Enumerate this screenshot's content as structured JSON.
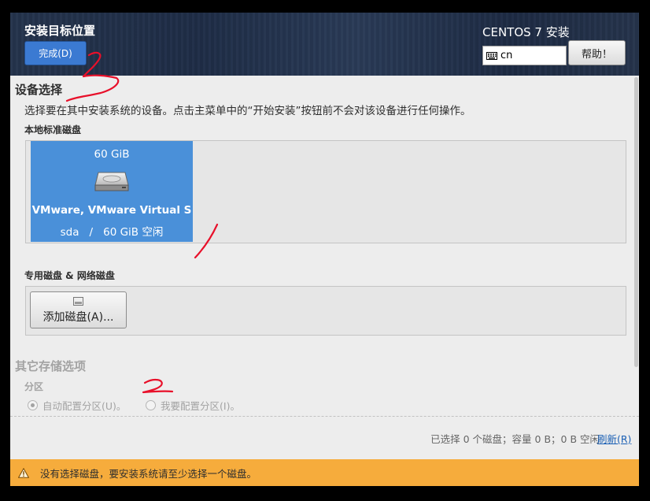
{
  "header": {
    "title": "安装目标位置",
    "done_label": "完成(D)",
    "product": "CENTOS 7 安装",
    "keyboard_layout": "cn",
    "help_label": "帮助！"
  },
  "device_selection": {
    "title": "设备选择",
    "description": "选择要在其中安装系统的设备。点击主菜单中的“开始安装”按钮前不会对该设备进行任何操作。",
    "local_title": "本地标准磁盘",
    "disks": [
      {
        "size": "60 GiB",
        "model": "VMware, VMware Virtual S",
        "name": "sda",
        "separator": "/",
        "free": "60 GiB 空闲",
        "selected": true
      }
    ],
    "special_title": "专用磁盘 & 网络磁盘",
    "add_disk_label": "添加磁盘(A)..."
  },
  "other_storage": {
    "title": "其它存储选项",
    "partition_title": "分区",
    "options": [
      {
        "label": "自动配置分区(U)。",
        "checked": true
      },
      {
        "label": "我要配置分区(I)。",
        "checked": false
      }
    ]
  },
  "footer": {
    "summary": "已选择 0 个磁盘；容量 0 B；0 B 空闲",
    "refresh_label": "刷新(R)"
  },
  "warning": {
    "text": "没有选择磁盘，要安装系统请至少选择一个磁盘。"
  },
  "colors": {
    "header_bg": "#25344d",
    "accent": "#4a90d9",
    "warning": "#f6ac3c",
    "annotation": "#e8102a"
  }
}
